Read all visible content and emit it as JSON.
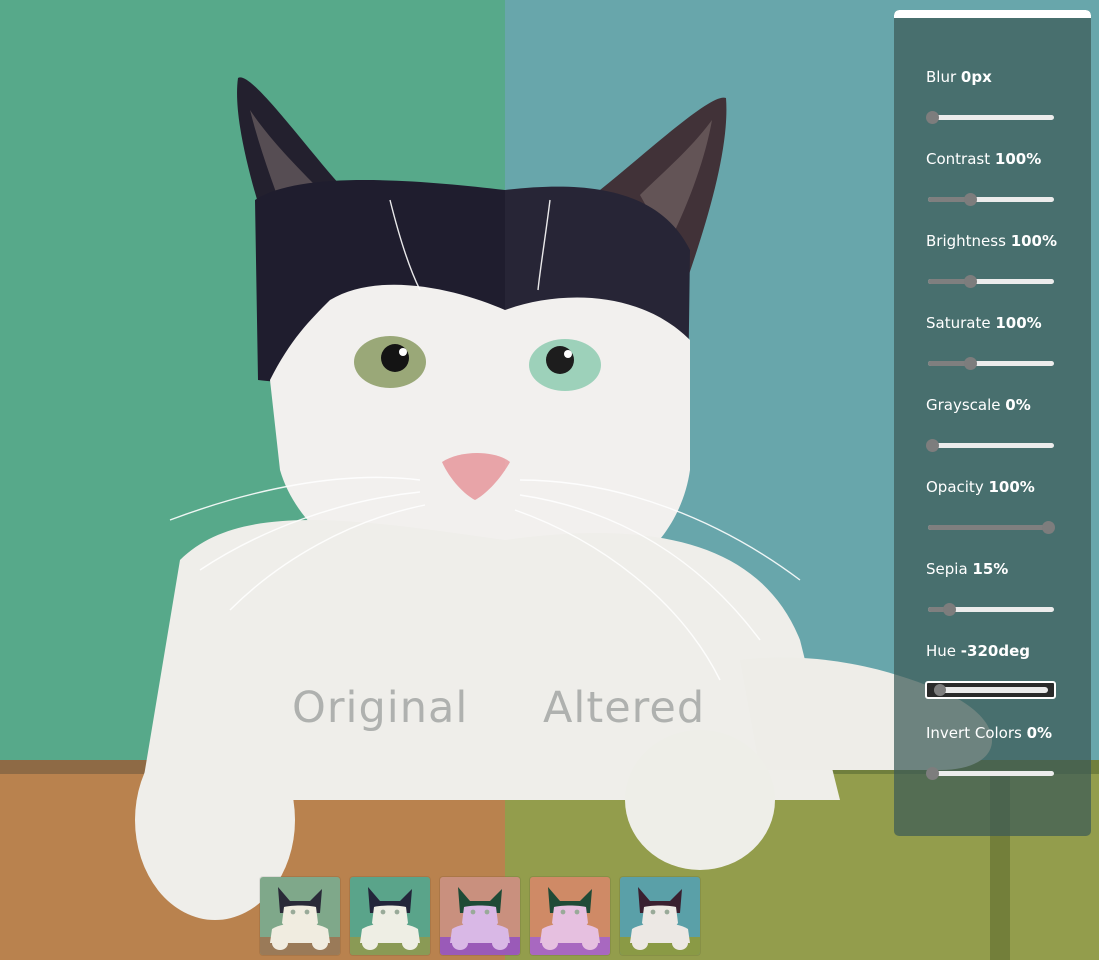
{
  "labels": {
    "original": "Original",
    "altered": "Altered"
  },
  "controls": [
    {
      "label": "Blur",
      "value": "0px",
      "level": 0
    },
    {
      "label": "Contrast",
      "value": "100%",
      "level": 0.33
    },
    {
      "label": "Brightness",
      "value": "100%",
      "level": 0.33
    },
    {
      "label": "Saturate",
      "value": "100%",
      "level": 0.33
    },
    {
      "label": "Grayscale",
      "value": "0%",
      "level": 0
    },
    {
      "label": "Opacity",
      "value": "100%",
      "level": 1
    },
    {
      "label": "Sepia",
      "value": "15%",
      "level": 0.15
    },
    {
      "label": "Hue",
      "value": "-320deg",
      "level": 0.05
    },
    {
      "label": "Invert Colors",
      "value": "0%",
      "level": 0
    }
  ],
  "thumbnails": [
    {
      "name": "preset-1",
      "bg": "#7fa88a",
      "head": "#2a2a38",
      "body": "#f0ece0",
      "ledge": "#9a7a58"
    },
    {
      "name": "preset-2",
      "bg": "#5aa48a",
      "head": "#23263a",
      "body": "#eeeee4",
      "ledge": "#8a9a55"
    },
    {
      "name": "preset-3",
      "bg": "#c9907e",
      "head": "#1e4a36",
      "body": "#d9b8e6",
      "ledge": "#9a5ab8"
    },
    {
      "name": "preset-4",
      "bg": "#cf8a66",
      "head": "#204a36",
      "body": "#e6c0e0",
      "ledge": "#a868c0"
    },
    {
      "name": "preset-5",
      "bg": "#5aa0a8",
      "head": "#3a2030",
      "body": "#ece8e4",
      "ledge": "#8a9a45"
    }
  ],
  "colors": {
    "original_bg": "#57a98a",
    "altered_bg": "#62a3a8",
    "panel_bg": "rgba(60,90,86,0.72)"
  }
}
